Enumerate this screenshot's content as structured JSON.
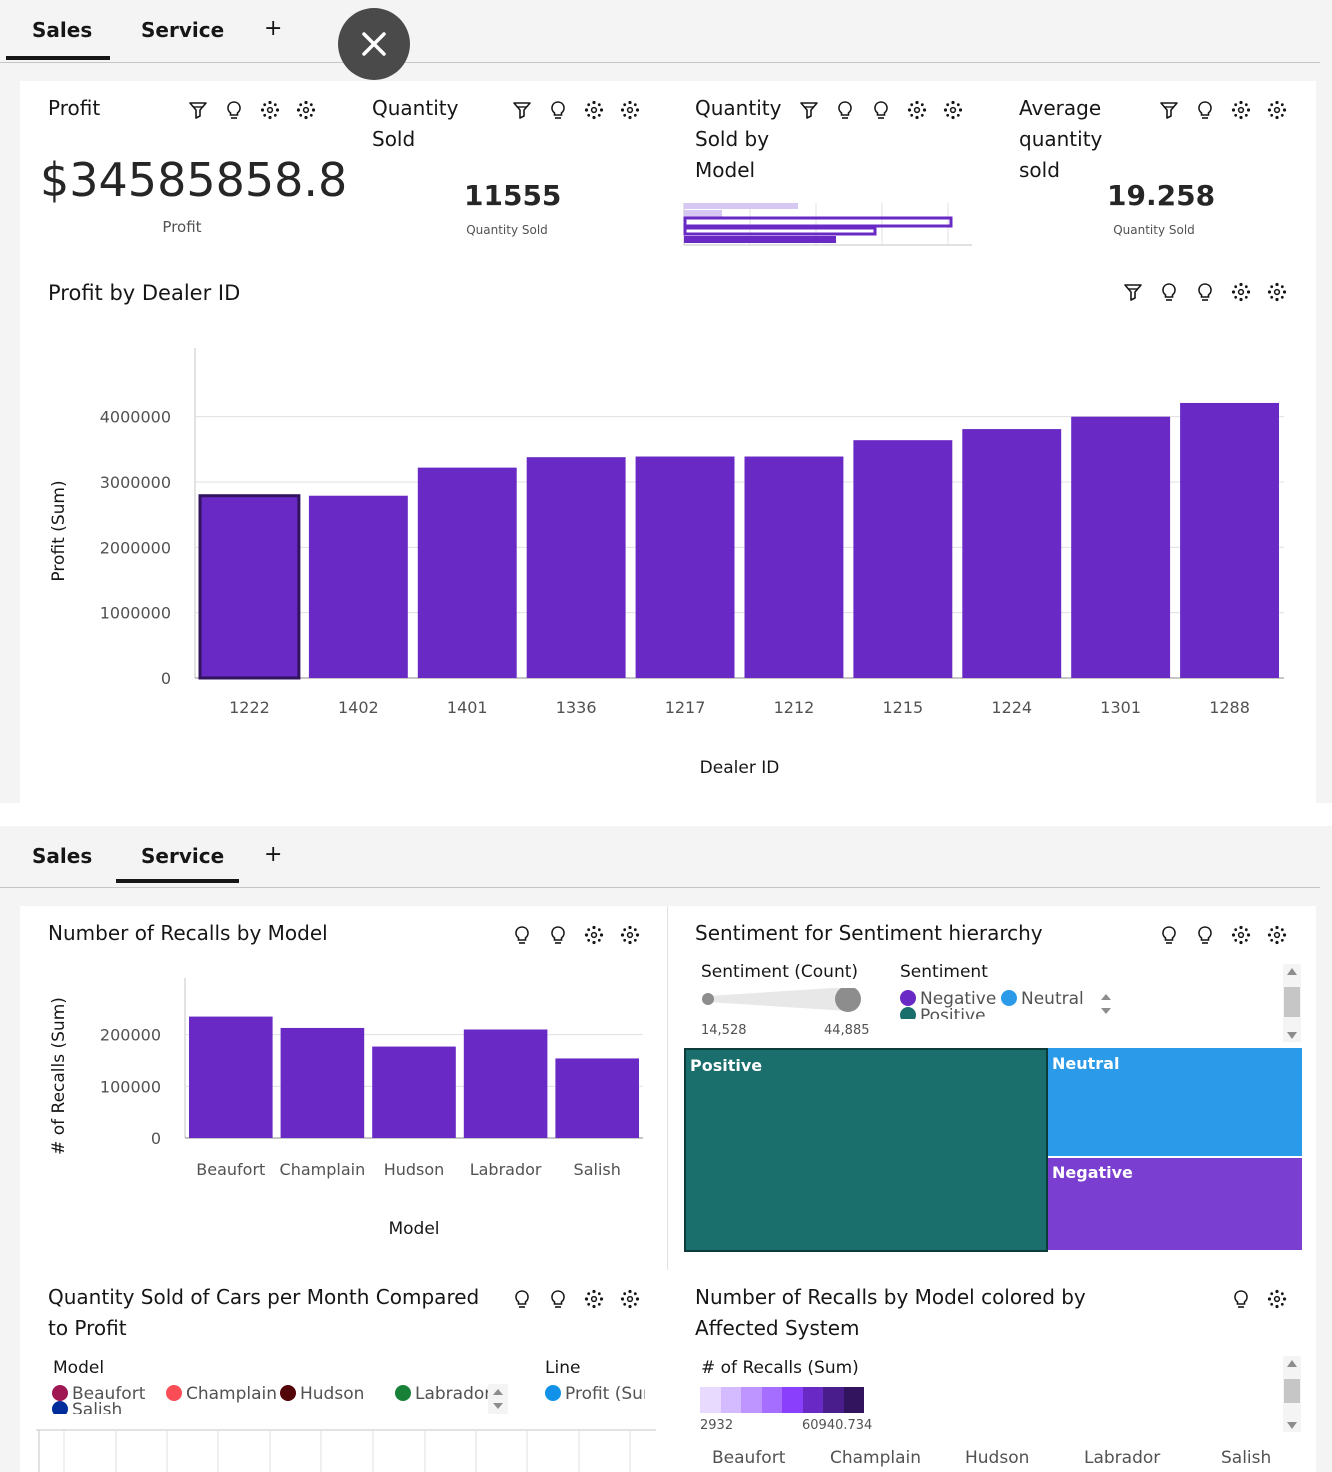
{
  "tabs_top": {
    "sales": "Sales",
    "service": "Service",
    "add": "+"
  },
  "tabs_bottom": {
    "sales": "Sales",
    "service": "Service",
    "add": "+"
  },
  "close_button": "×",
  "kpi": {
    "profit": {
      "title": "Profit",
      "value": "$34585858.8",
      "caption": "Profit"
    },
    "quantity": {
      "title": "Quantity Sold",
      "value": "11555",
      "caption": "Quantity Sold"
    },
    "by_model": {
      "title": "Quantity Sold by Model"
    },
    "average": {
      "title": "Average quantity sold",
      "value": "19.258",
      "caption": "Quantity Sold"
    }
  },
  "profit_chart_title": "Profit by Dealer ID",
  "recalls_title": "Number of Recalls by Model",
  "sentiment": {
    "title": "Sentiment for Sentiment hierarchy",
    "count_label": "Sentiment (Count)",
    "min": "14,528",
    "max": "44,885",
    "legend_title": "Sentiment",
    "legend": [
      "Negative",
      "Neutral",
      "Positive"
    ],
    "treemap": [
      "Positive",
      "Neutral",
      "Negative"
    ]
  },
  "qty_month": {
    "title": "Quantity Sold of Cars per Month Compared to Profit",
    "model_label": "Model",
    "models": [
      "Beaufort",
      "Champlain",
      "Hudson",
      "Labrador",
      "Salish"
    ],
    "line_label": "Line",
    "line_item": "Profit (Sur"
  },
  "recalls_system": {
    "title": "Number of Recalls by Model colored by Affected System",
    "scale_label": "# of Recalls (Sum)",
    "min": "2932",
    "max": "60940.734",
    "columns": [
      "Beaufort",
      "Champlain",
      "Hudson",
      "Labrador",
      "Salish"
    ]
  },
  "colors": {
    "purple": "#6929c4",
    "teal": "#1a6e6b",
    "blue": "#2b9ae8",
    "negative": "#7a3fd0"
  },
  "chart_data": [
    {
      "type": "bar",
      "title": "Profit by Dealer ID",
      "xlabel": "Dealer ID",
      "ylabel": "Profit (Sum)",
      "categories": [
        "1222",
        "1402",
        "1401",
        "1336",
        "1217",
        "1212",
        "1215",
        "1224",
        "1301",
        "1288"
      ],
      "values": [
        2790000,
        2790000,
        3220000,
        3380000,
        3390000,
        3390000,
        3640000,
        3810000,
        4000000,
        4210000
      ],
      "yticks": [
        "0",
        "1000000",
        "2000000",
        "3000000",
        "4000000"
      ],
      "ylim": [
        0,
        4500000
      ],
      "grid": true
    },
    {
      "type": "bar",
      "title": "Number of Recalls by Model",
      "xlabel": "Model",
      "ylabel": "# of Recalls (Sum)",
      "categories": [
        "Beaufort",
        "Champlain",
        "Hudson",
        "Labrador",
        "Salish"
      ],
      "values": [
        235000,
        213000,
        177000,
        210000,
        154000
      ],
      "yticks": [
        "0",
        "100000",
        "200000"
      ],
      "ylim": [
        0,
        240000
      ],
      "grid": true
    }
  ]
}
